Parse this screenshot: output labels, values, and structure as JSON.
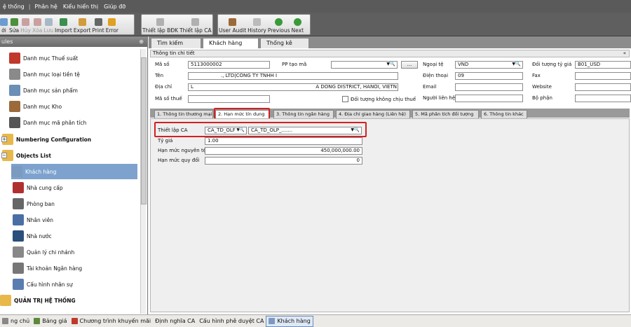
{
  "menu": [
    "ệ thống",
    "Phân hệ",
    "Kiểu hiển thị",
    "Giúp đỡ"
  ],
  "toolbar": {
    "group1": [
      {
        "label": "ới",
        "icon": "new-icon",
        "disabled": false
      },
      {
        "label": "Sửa",
        "icon": "edit-icon",
        "disabled": false
      },
      {
        "label": "Hủy",
        "icon": "cancel-icon",
        "disabled": true
      },
      {
        "label": "Xóa",
        "icon": "delete-icon",
        "disabled": true
      },
      {
        "label": "Lưu",
        "icon": "save-icon",
        "disabled": true
      },
      {
        "label": "Import",
        "icon": "import-icon",
        "disabled": false
      },
      {
        "label": "Export",
        "icon": "export-icon",
        "disabled": false
      },
      {
        "label": "Print",
        "icon": "print-icon",
        "disabled": false
      },
      {
        "label": "Error",
        "icon": "error-icon",
        "disabled": false
      }
    ],
    "group2": [
      {
        "label": "Thiết lập BĐK",
        "icon": "settings-icon"
      },
      {
        "label": "Thiết lập CA",
        "icon": "settings-icon"
      }
    ],
    "group3": [
      {
        "label": "User Audit",
        "icon": "user-audit-icon"
      },
      {
        "label": "History",
        "icon": "history-icon"
      },
      {
        "label": "Previous",
        "icon": "previous-icon"
      },
      {
        "label": "Next",
        "icon": "next-icon"
      }
    ]
  },
  "left_panel": {
    "title": "ules",
    "items": [
      {
        "label": "Danh mục Thuế suất",
        "icon": "tax-icon",
        "color": "#c0392b"
      },
      {
        "label": "Danh mục loại tiền tệ",
        "icon": "currency-icon",
        "color": "#8a8a8a"
      },
      {
        "label": "Danh mục sản phẩm",
        "icon": "product-icon",
        "color": "#6b8fb5"
      },
      {
        "label": "Danh mục Kho",
        "icon": "warehouse-icon",
        "color": "#9c6a3a"
      },
      {
        "label": "Danh mục mã phân tích",
        "icon": "analysis-icon",
        "color": "#555555"
      },
      {
        "label": "Numbering Configuration",
        "icon": "folder-icon",
        "color": "#e8b84a",
        "bold": true
      },
      {
        "label": "Objects List",
        "icon": "folder-icon",
        "color": "#e8b84a",
        "bold": true
      },
      {
        "label": "Khách hàng",
        "icon": "customer-icon",
        "color": "#7b9ac0",
        "selected": true
      },
      {
        "label": "Nhà cung cấp",
        "icon": "supplier-icon",
        "color": "#b03030"
      },
      {
        "label": "Phòng ban",
        "icon": "department-icon",
        "color": "#666666"
      },
      {
        "label": "Nhân viên",
        "icon": "employee-icon",
        "color": "#4a6fa5"
      },
      {
        "label": "Nhà nước",
        "icon": "government-icon",
        "color": "#2a4f7a"
      },
      {
        "label": "Quản lý chi nhánh",
        "icon": "branch-icon",
        "color": "#888888"
      },
      {
        "label": "Tài khoản Ngân hàng",
        "icon": "bank-account-icon",
        "color": "#777777"
      },
      {
        "label": "Cấu hình nhân sự",
        "icon": "hr-config-icon",
        "color": "#5a7db0"
      },
      {
        "label": "QUẢN TRỊ HỆ THỐNG",
        "icon": "folder-icon",
        "color": "#e8b84a",
        "bold": true
      }
    ]
  },
  "top_tabs": [
    "Tìm kiếm",
    "Khách hàng",
    "Thống kê"
  ],
  "detail": {
    "title": "Thông tin chi tiết",
    "labels": {
      "ma_so": "Mã số",
      "ten": "Tên",
      "dia_chi": "Địa chỉ",
      "ma_so_thue": "Mã số thuế",
      "pp_tao_ma": "PP tạo mã",
      "ngoai_te": "Ngoại tệ",
      "dien_thoai": "Điện thoại",
      "email": "Email",
      "nguoi_lien_he": "Người liên hệ",
      "doi_tuong_ty_gia": "Đối tượng tỷ giá",
      "fax": "Fax",
      "website": "Website",
      "bo_phan": "Bộ phận",
      "khong_chiu_thue": "Đối tượng không chịu thuế"
    },
    "values": {
      "ma_so": "5113000002",
      "ten": "., LTD|CÔNG TY TNHH I",
      "dia_chi_left": "L",
      "dia_chi_right": "A DONG DISTRICT, HANOI, VIETN",
      "ngoai_te": "VND",
      "dien_thoai": "09",
      "doi_tuong_ty_gia": "B01_USD",
      "ellipsis": "..."
    }
  },
  "sub_tabs": [
    "1. Thông tin thương mại",
    "2. Hạn mức tín dụng",
    "3. Thông tin ngân hàng",
    "4. Địa chỉ giao hàng (Liên hệ)",
    "5. Mã phân tích đối tượng",
    "6. Thông tin khác"
  ],
  "credit": {
    "labels": {
      "thiet_lap_ca": "Thiết lập CA",
      "ty_gia": "Tỷ giá",
      "han_muc_nguyen_te": "Hạn mức nguyên tệ",
      "han_muc_quy_doi": "Hạn mức quy đổi"
    },
    "ca_code": "CA_TD_OLF",
    "ca_name": "CA_TD_OLP_.......",
    "ty_gia": "1.00",
    "han_muc_nguyen_te": "450,000,000.00",
    "han_muc_quy_doi": "0"
  },
  "status_tabs": [
    {
      "label": "ng chủ",
      "icon": "home-icon",
      "color": "#888888"
    },
    {
      "label": "Bảng giá",
      "icon": "price-list-icon",
      "color": "#5c8a3a"
    },
    {
      "label": "Chương trình khuyến mãi",
      "icon": "promotion-icon",
      "color": "#c0392b"
    },
    {
      "label": "Định nghĩa CA",
      "icon": "",
      "color": ""
    },
    {
      "label": "Cấu hình phê duyệt CA",
      "icon": "",
      "color": ""
    },
    {
      "label": "Khách hàng",
      "icon": "customer-icon",
      "color": "#7b9ac0",
      "active": true
    }
  ],
  "colors": {
    "highlight": "#d32020",
    "selection": "#7da2ce"
  }
}
